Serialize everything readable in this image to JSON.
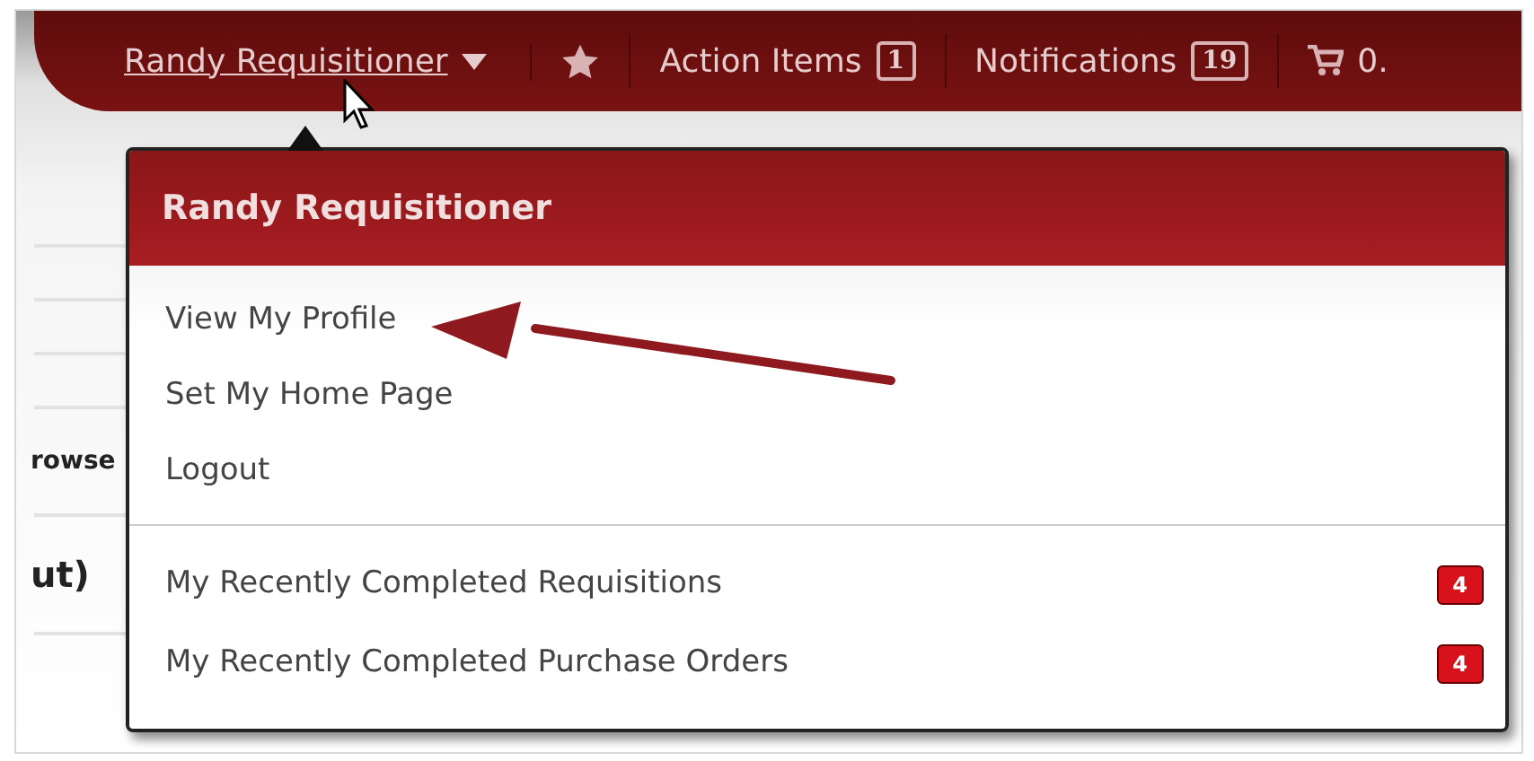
{
  "top_bar": {
    "user": "Randy Requisitioner",
    "items": [
      {
        "kind": "icon"
      },
      {
        "kind": "count",
        "label": "Action Items",
        "count": "1"
      },
      {
        "kind": "count",
        "label": "Notifications",
        "count": "19"
      },
      {
        "kind": "cart",
        "label": "0."
      }
    ]
  },
  "background": {
    "texts": [
      "rowse",
      "ut)"
    ]
  },
  "menu": {
    "title": "Randy Requisitioner",
    "items": [
      "View My Profile",
      "Set My Home Page",
      "Logout"
    ],
    "recent": [
      {
        "label": "My Recently Completed Requisitions",
        "count": "4"
      },
      {
        "label": "My Recently Completed Purchase Orders",
        "count": "4"
      }
    ]
  }
}
